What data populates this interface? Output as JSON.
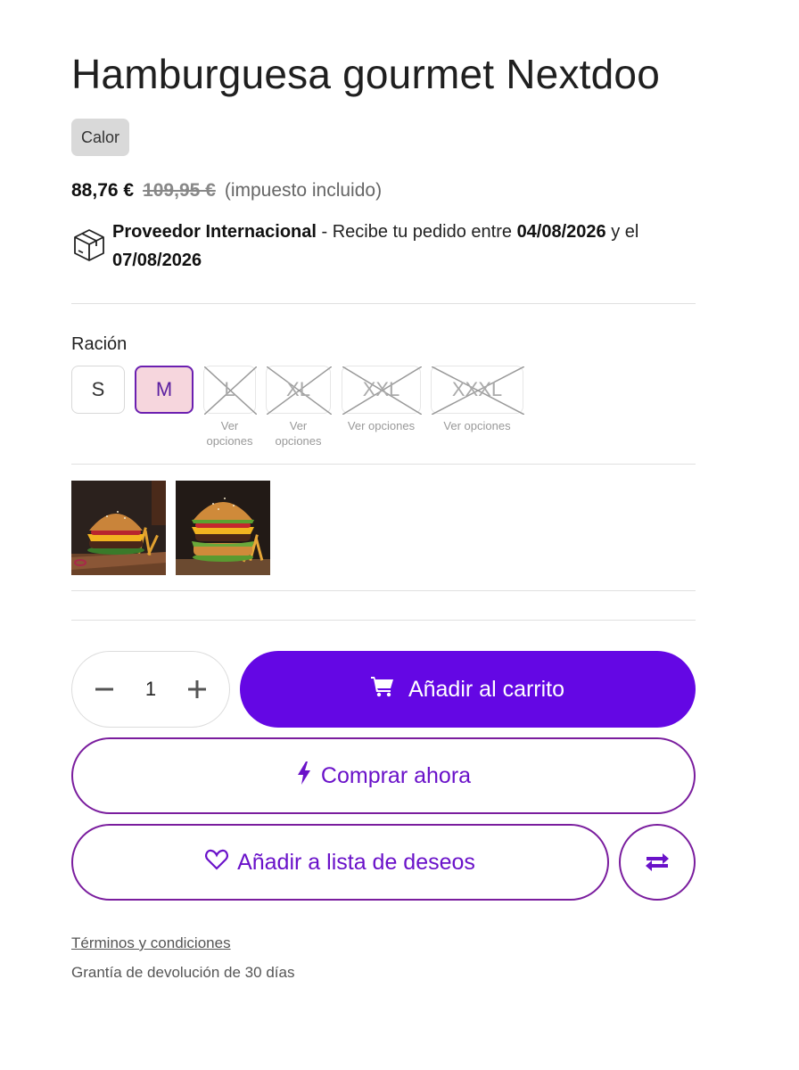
{
  "product": {
    "title": "Hamburguesa gourmet Nextdoo",
    "badge": "Calor",
    "price": "88,76 €",
    "old_price": "109,95 €",
    "tax_note": "(impuesto incluido)"
  },
  "shipping": {
    "provider": "Proveedor Internacional",
    "text_1": " - Recibe tu pedido entre ",
    "date_from": "04/08/2026",
    "text_2": " y el ",
    "date_to": "07/08/2026"
  },
  "variant": {
    "label": "Ración",
    "options": [
      {
        "label": "S",
        "state": "available"
      },
      {
        "label": "M",
        "state": "selected"
      },
      {
        "label": "L",
        "state": "unavailable",
        "note": "Ver opciones"
      },
      {
        "label": "XL",
        "state": "unavailable",
        "note": "Ver opciones"
      },
      {
        "label": "XXL",
        "state": "unavailable",
        "note": "Ver opciones"
      },
      {
        "label": "XXXL",
        "state": "unavailable",
        "note": "Ver opciones"
      }
    ]
  },
  "thumbnails": [
    "burger-thumbnail-1",
    "burger-thumbnail-2"
  ],
  "quantity": {
    "value": "1",
    "minus": "−",
    "plus": "+"
  },
  "actions": {
    "add_to_cart": "Añadir al carrito",
    "buy_now": "Comprar ahora",
    "wishlist": "Añadir a lista de deseos"
  },
  "footer": {
    "terms": "Términos y condiciones",
    "returns": "Grantía de devolución de 30 días"
  },
  "colors": {
    "accent": "#6407e4",
    "selected_bg": "#f6d6dd",
    "outline": "#7a1d9e"
  },
  "icons": [
    "box-icon",
    "cart-icon",
    "bolt-icon",
    "heart-icon",
    "compare-arrows-icon",
    "minus-icon",
    "plus-icon"
  ]
}
